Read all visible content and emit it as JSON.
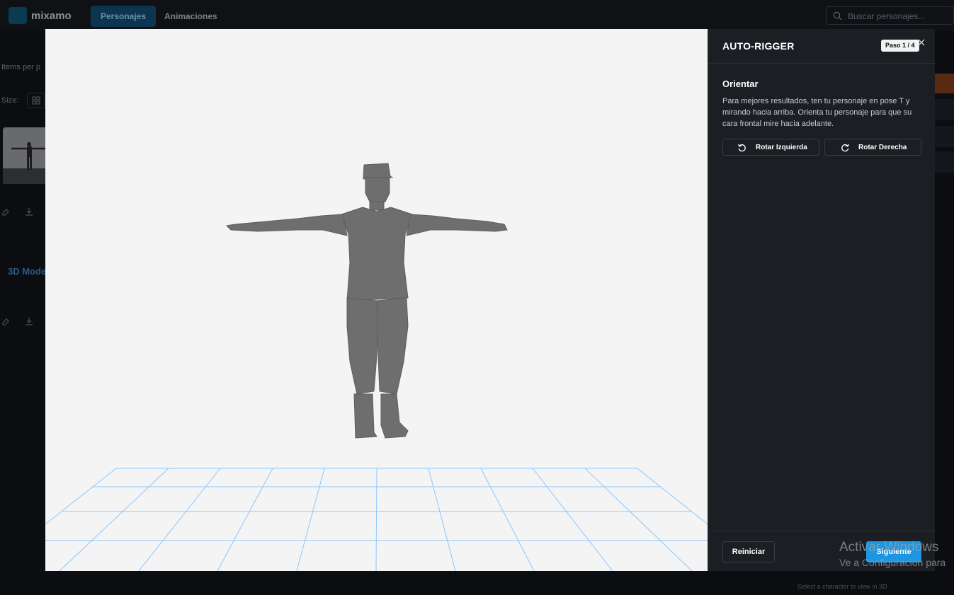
{
  "app": {
    "logo_text": "mixamo",
    "nav": {
      "characters": "Personajes",
      "animations": "Animaciones"
    },
    "search_placeholder": "Buscar personajes...",
    "items_per_page_partial": "Items per p",
    "size_label": "Size:",
    "card_title_partial": "3D Mode",
    "status_text": "Select a character to view in 3D"
  },
  "modal": {
    "title": "AUTO-RIGGER",
    "step": "Paso 1 / 4",
    "section_title": "Orientar",
    "description": "Para mejores resultados, ten tu personaje en pose T y mirando hacia arriba. Orienta tu personaje para que su cara frontal mire hacia adelante.",
    "rotate_left": "Rotar Izquierda",
    "rotate_right": "Rotar Derecha",
    "reset": "Reiniciar",
    "next": "Siguiente"
  },
  "watermark": {
    "line1": "Activar Windows",
    "line2": "Ve a Configuración para"
  },
  "colors": {
    "accent": "#1c96e3",
    "grid": "#7fc0ff",
    "model": "#6e6e6e",
    "viewport_bg": "#f4f4f4",
    "panel_bg": "#1b1e22"
  }
}
